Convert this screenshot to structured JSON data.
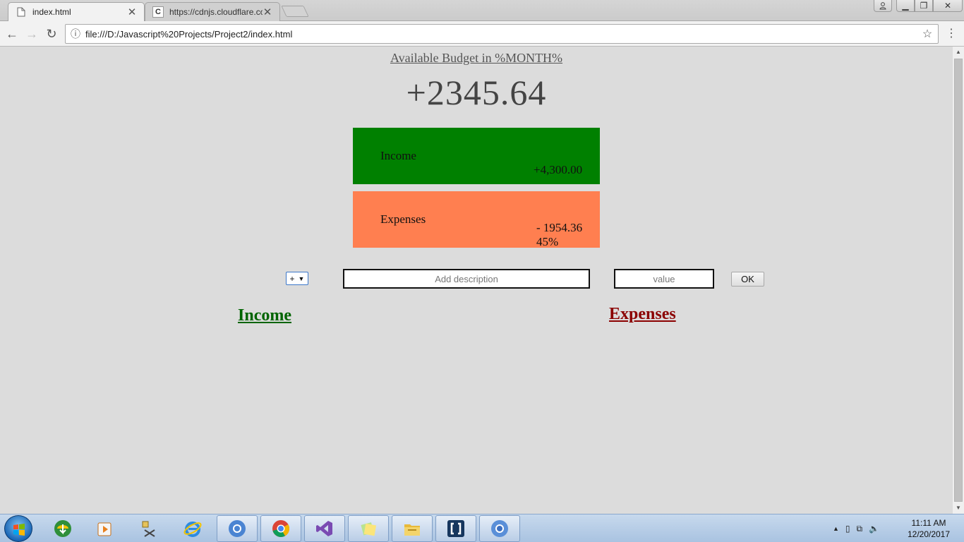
{
  "browser": {
    "tabs": [
      {
        "title": "index.html",
        "favicon": "page-icon",
        "active": true
      },
      {
        "title": "https://cdnjs.cloudflare.com",
        "favicon": "c-letter-icon",
        "favicon_letter": "C",
        "active": false
      }
    ],
    "address": "file:///D:/Javascript%20Projects/Project2/index.html"
  },
  "page": {
    "budget_heading": "Available Budget in %MONTH%",
    "budget_value": "+2345.64",
    "income_summary": {
      "label": "Income",
      "value": "+4,300.00",
      "color": "#008000"
    },
    "expenses_summary": {
      "label": "Expenses",
      "value": "- 1954.36",
      "percentage": "45%",
      "color": "#ff7f50"
    },
    "form": {
      "type_selected": "+",
      "description_placeholder": "Add description",
      "value_placeholder": "value",
      "ok_label": "OK"
    },
    "income_list_title": "Income",
    "expenses_list_title": "Expenses",
    "colors": {
      "income_title": "#006400",
      "expenses_title": "#8b0000"
    }
  },
  "taskbar": {
    "items": [
      {
        "icon": "internet-download-manager-icon",
        "running": false
      },
      {
        "icon": "media-player-icon",
        "running": false
      },
      {
        "icon": "tools-icon",
        "running": false
      },
      {
        "icon": "internet-explorer-icon",
        "running": false
      },
      {
        "icon": "chrome-canary-icon",
        "running": true
      },
      {
        "icon": "chrome-icon",
        "running": true
      },
      {
        "icon": "visual-studio-icon",
        "running": true
      },
      {
        "icon": "sticky-notes-icon",
        "running": true
      },
      {
        "icon": "file-explorer-icon",
        "running": true
      },
      {
        "icon": "brackets-icon",
        "running": true
      },
      {
        "icon": "chromium-icon",
        "running": true
      }
    ],
    "clock_time": "11:11 AM",
    "clock_date": "12/20/2017"
  }
}
